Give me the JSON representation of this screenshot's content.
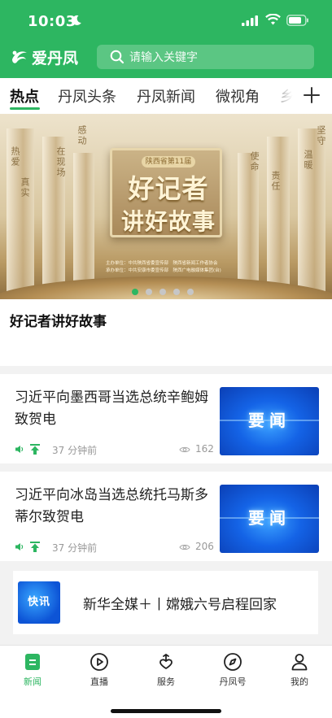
{
  "status": {
    "time": "10:03"
  },
  "header": {
    "brand": "爱丹凤",
    "search_placeholder": "请输入关键字"
  },
  "tabs": [
    {
      "label": "热点",
      "active": true
    },
    {
      "label": "丹凤头条",
      "active": false
    },
    {
      "label": "丹凤新闻",
      "active": false
    },
    {
      "label": "微视角",
      "active": false
    },
    {
      "label": "乡",
      "active": false
    }
  ],
  "banner": {
    "board_tag": "陕西省第11届",
    "headline_line1": "好记者",
    "headline_line2": "讲好故事",
    "pillar_words": [
      "坚守",
      "热爱",
      "在现场",
      "真实",
      "使命",
      "责任",
      "感动",
      "温暖"
    ],
    "organizers": [
      "主办单位：中共陕西省委宣传部　陕西省新闻工作者协会",
      "承办单位：中共安康市委宣传部　陕西广电融媒体集团(台)"
    ],
    "slides_total": 5,
    "active_slide": 1
  },
  "feature_title": "好记者讲好故事",
  "news": [
    {
      "title": "习近平向墨西哥当选总统辛鲍姆致贺电",
      "time_ago": "37 分钟前",
      "views": "162",
      "thumb_label": "要闻"
    },
    {
      "title": "习近平向冰岛当选总统托马斯多蒂尔致贺电",
      "time_ago": "37 分钟前",
      "views": "206",
      "thumb_label": "要闻"
    }
  ],
  "flash": {
    "badge": "快讯",
    "text": "新华全媒＋丨嫦娥六号启程回家"
  },
  "bottom_nav": [
    {
      "label": "新闻",
      "icon": "news-icon",
      "active": true
    },
    {
      "label": "直播",
      "icon": "play-icon",
      "active": false
    },
    {
      "label": "服务",
      "icon": "service-heart-icon",
      "active": false
    },
    {
      "label": "丹凤号",
      "icon": "compass-icon",
      "active": false
    },
    {
      "label": "我的",
      "icon": "user-icon",
      "active": false
    }
  ],
  "colors": {
    "brand_green": "#2db661",
    "news_blue": "#1463e6",
    "gold": "#c9b084"
  }
}
